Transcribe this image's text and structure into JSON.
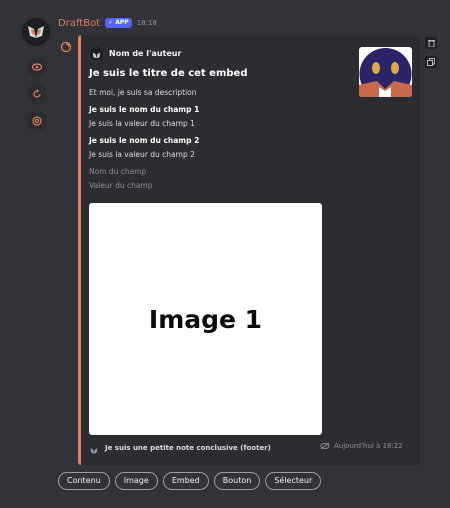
{
  "message": {
    "author": "DraftBot",
    "badge": "APP",
    "timestamp": "18:18"
  },
  "embed": {
    "color": "#e0805f",
    "author_name": "Nom de l'auteur",
    "title": "Je suis le titre de cet embed",
    "description": "Et moi, je suis sa description",
    "fields": [
      {
        "name": "Je suis le nom du champ 1",
        "value": "Je suis la valeur du champ 1"
      },
      {
        "name": "Je suis le nom du champ 2",
        "value": "Je suis la valeur du champ 2"
      },
      {
        "name": "Nom du champ",
        "value": "Valeur du champ"
      }
    ],
    "image_label": "Image 1",
    "footer_text": "Je suis une petite note conclusive (footer)",
    "footer_time": "Aujourd'hui à 18:22"
  },
  "buttons": [
    "Contenu",
    "Image",
    "Embed",
    "Bouton",
    "Sélecteur"
  ],
  "icons": {
    "rail": [
      "eye-icon",
      "refresh-icon",
      "at-sign-icon"
    ],
    "side": [
      "trash-icon",
      "copy-icon"
    ]
  }
}
